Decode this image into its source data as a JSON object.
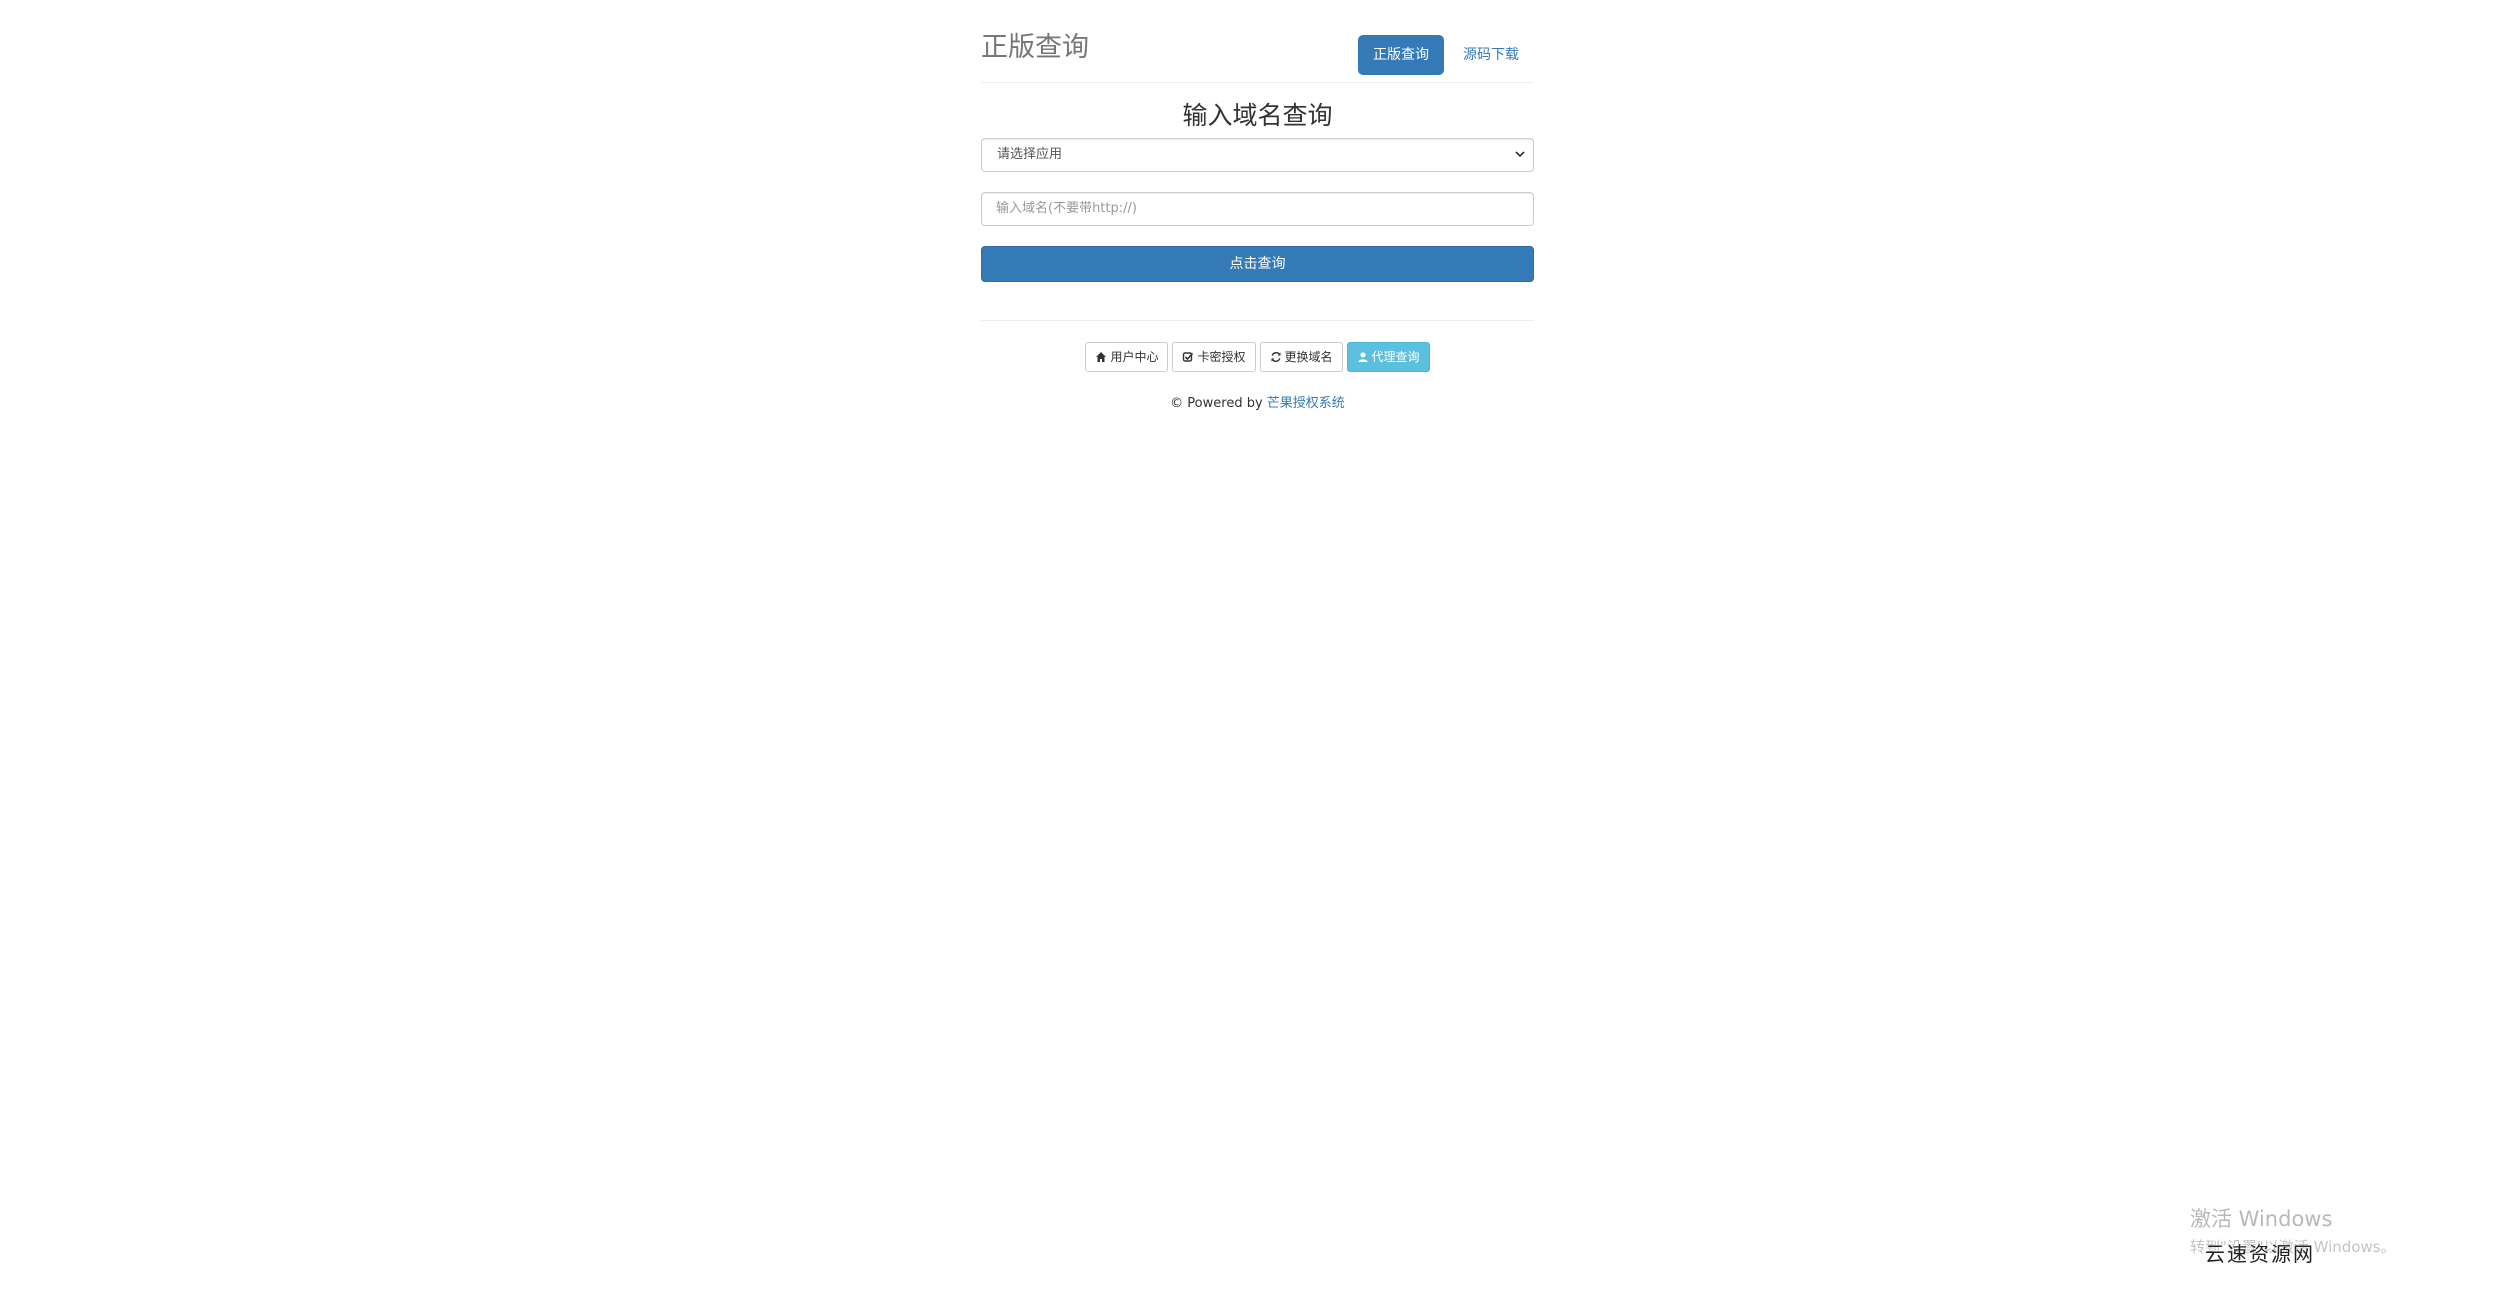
{
  "header": {
    "brand": "正版查询",
    "nav": [
      {
        "label": "正版查询",
        "active": true
      },
      {
        "label": "源码下载",
        "active": false
      }
    ]
  },
  "main": {
    "heading": "输入域名查询",
    "select": {
      "value": "请选择应用"
    },
    "domain_input": {
      "placeholder": "输入域名(不要带http://)",
      "value": ""
    },
    "submit_label": "点击查询"
  },
  "actions": [
    {
      "icon": "home-icon",
      "label": "用户中心"
    },
    {
      "icon": "check-square-icon",
      "label": "卡密授权"
    },
    {
      "icon": "refresh-icon",
      "label": "更换域名"
    },
    {
      "icon": "user-icon",
      "label": "代理查询"
    }
  ],
  "footer": {
    "prefix": "© Powered by ",
    "link": "芒果授权系统"
  },
  "overlay": {
    "activate_title": "激活 Windows",
    "activate_sub": "转到\"设置\"以激活 Windows。",
    "site_watermark": "云速资源网"
  },
  "colors": {
    "primary": "#337ab7",
    "info": "#5bc0de",
    "border": "#cccccc"
  }
}
